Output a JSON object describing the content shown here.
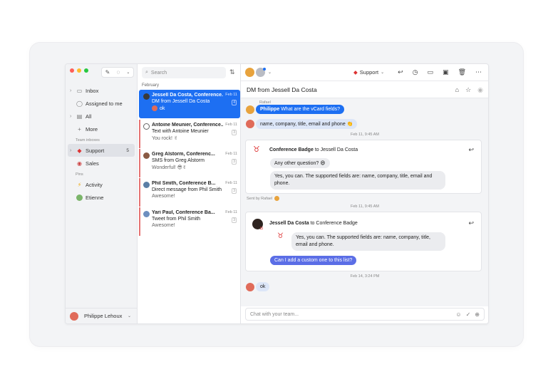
{
  "colors": {
    "accent": "#1d6ff2",
    "purple": "#5b6ee6",
    "unread_bar": "#e57373"
  },
  "sidebar": {
    "items_top": [
      {
        "label": "Inbox",
        "icon": "inbox-icon",
        "chevron": true
      },
      {
        "label": "Assigned to me",
        "icon": "person-icon",
        "chevron": false
      },
      {
        "label": "All",
        "icon": "all-icon",
        "chevron": true
      },
      {
        "label": "More",
        "icon": "plus-icon",
        "chevron": false
      }
    ],
    "team_label": "Team inboxes",
    "team_items": [
      {
        "label": "Support",
        "count": "5",
        "active": true
      },
      {
        "label": "Sales",
        "count": "",
        "active": false
      }
    ],
    "pins_label": "Pins",
    "pin_items": [
      {
        "label": "Activity"
      },
      {
        "label": "Etienne"
      }
    ],
    "user_name": "Philippe Lehoux"
  },
  "list": {
    "search_placeholder": "Search",
    "month": "February",
    "conversations": [
      {
        "subject": "Jessell Da Costa, Conference...",
        "date": "Feb 11",
        "line2": "DM from Jessell Da Costa",
        "line3": "ok",
        "count": "4",
        "selected": true
      },
      {
        "subject": "Antoine Meunier, Conference...",
        "date": "Feb 11",
        "line2": "Text with Antoine Meunier",
        "line3": "You rock! ✌",
        "count": "3",
        "selected": false
      },
      {
        "subject": "Greg Alstorm, Conferenc...",
        "date": "Feb 11",
        "line2": "SMS from Greg Alstorm",
        "line3": "Wonderful! 😎✌",
        "count": "3",
        "selected": false
      },
      {
        "subject": "Phil Smith, Conference B...",
        "date": "Feb 11",
        "line2": "Direct message from Phil Smith",
        "line3": "Awesome!",
        "count": "3",
        "selected": false
      },
      {
        "subject": "Yari Paul, Conference Ba...",
        "date": "Feb 11",
        "line2": "Tweet from Phil Smith",
        "line3": "Awesome!",
        "count": "3",
        "selected": false
      }
    ]
  },
  "main": {
    "inbox_selector": "Support",
    "subject": "DM from Jessell Da Costa",
    "thread": {
      "rafael_label": "Rafael",
      "philippe_name": "Philippe",
      "philippe_msg": "What are the vCard fields?",
      "reply_fields": "name, company, title, email and phone 👏",
      "ts1": "Feb 11, 9:45 AM",
      "card1_sender": "Conference Badge",
      "card1_to": "to Jessell Da Costa",
      "card1_msg1": "Any other question? 😄",
      "card1_msg2": "Yes, you can. The supported fields are: name, company, title, email and phone.",
      "sent_by": "Sent by Rafael",
      "ts2": "Feb 11, 9:45 AM",
      "card2_sender": "Jessell Da Costa",
      "card2_to": "to Conference Badge",
      "card2_quote": "Yes, you can. The supported fields are: name, company, title, email and phone.",
      "card2_msg": "Can I add a custom one to this list?",
      "ts3": "Feb 14, 3:24 PM",
      "last_msg": "ok"
    },
    "composer_placeholder": "Chat with your team..."
  }
}
